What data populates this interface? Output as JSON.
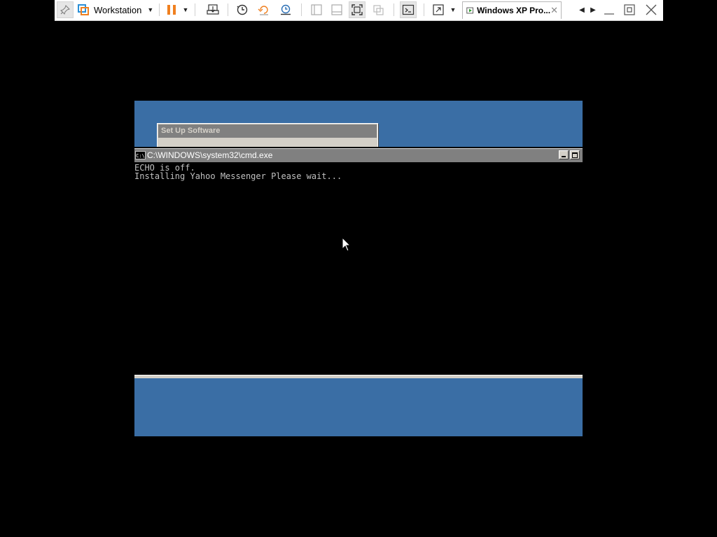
{
  "toolbar": {
    "workstation_label": "Workstation",
    "tab_label": "Windows XP Pro...",
    "tab_close_glyph": "✕"
  },
  "guest": {
    "setup_window": {
      "title": "Set Up Software"
    },
    "cmd_window": {
      "title": "C:\\WINDOWS\\system32\\cmd.exe",
      "icon_text": "C:\\",
      "lines": [
        "ECHO is off.",
        "Installing Yahoo Messenger Please wait..."
      ]
    }
  },
  "colors": {
    "desktop": "#3a6ea5",
    "pause_accent": "#f08020",
    "vmware_icon": "#2b8fd6"
  }
}
